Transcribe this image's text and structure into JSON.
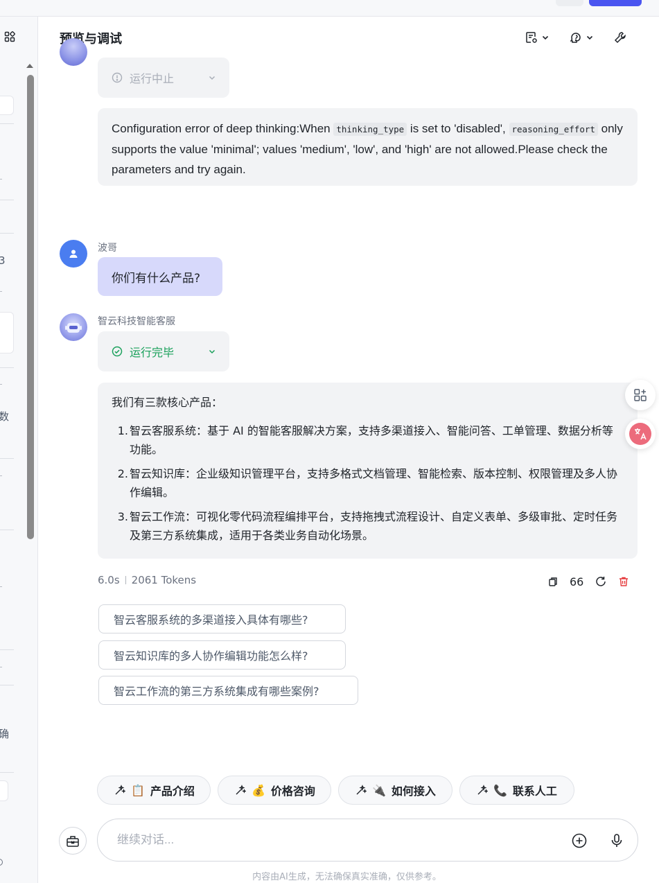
{
  "header": {
    "title": "预览与调试"
  },
  "sidebar": {
    "chars": [
      "3",
      "数",
      "确"
    ]
  },
  "conversation": {
    "error_status": "运行中止",
    "error_text_1": "Configuration error of deep thinking:When ",
    "error_code_1": "thinking_type",
    "error_text_2": " is set to 'disabled', ",
    "error_code_2": "reasoning_effort",
    "error_text_3": " only supports the value 'minimal'; values 'medium', 'low', and 'high' are not allowed.Please check the parameters and try again.",
    "user_name": "波哥",
    "user_message": "你们有什么产品?",
    "bot_name": "智云科技智能客服",
    "bot_status": "运行完毕",
    "answer_intro": "我们有三款核心产品：",
    "answer_items": [
      {
        "num": "1.",
        "text": "智云客服系统：基于 AI 的智能客服解决方案，支持多渠道接入、智能问答、工单管理、数据分析等功能。"
      },
      {
        "num": "2.",
        "text": "智云知识库：企业级知识管理平台，支持多格式文档管理、智能检索、版本控制、权限管理及多人协作编辑。"
      },
      {
        "num": "3.",
        "text": "智云工作流：可视化零代码流程编排平台，支持拖拽式流程设计、自定义表单、多级审批、定时任务及第三方系统集成，适用于各类业务自动化场景。"
      }
    ],
    "meta_time": "6.0s",
    "meta_tokens": "2061 Tokens",
    "quote_label": "66"
  },
  "suggestions": [
    "智云客服系统的多渠道接入具体有哪些?",
    "智云知识库的多人协作编辑功能怎么样?",
    "智云工作流的第三方系统集成有哪些案例?"
  ],
  "quick_chips": [
    {
      "emoji": "📋",
      "label": "产品介绍"
    },
    {
      "emoji": "💰",
      "label": "价格咨询"
    },
    {
      "emoji": "🔌",
      "label": "如何接入"
    },
    {
      "emoji": "📞",
      "label": "联系人工"
    }
  ],
  "input": {
    "placeholder": "继续对话..."
  },
  "disclaimer": "内容由AI生成，无法确保真实准确，仅供参考。",
  "colors": {
    "accent": "#4a55f0",
    "success": "#1aa05b",
    "danger": "#e5393b",
    "user_bubble": "#d7d9fb",
    "bot_bubble": "#f2f3f5"
  }
}
